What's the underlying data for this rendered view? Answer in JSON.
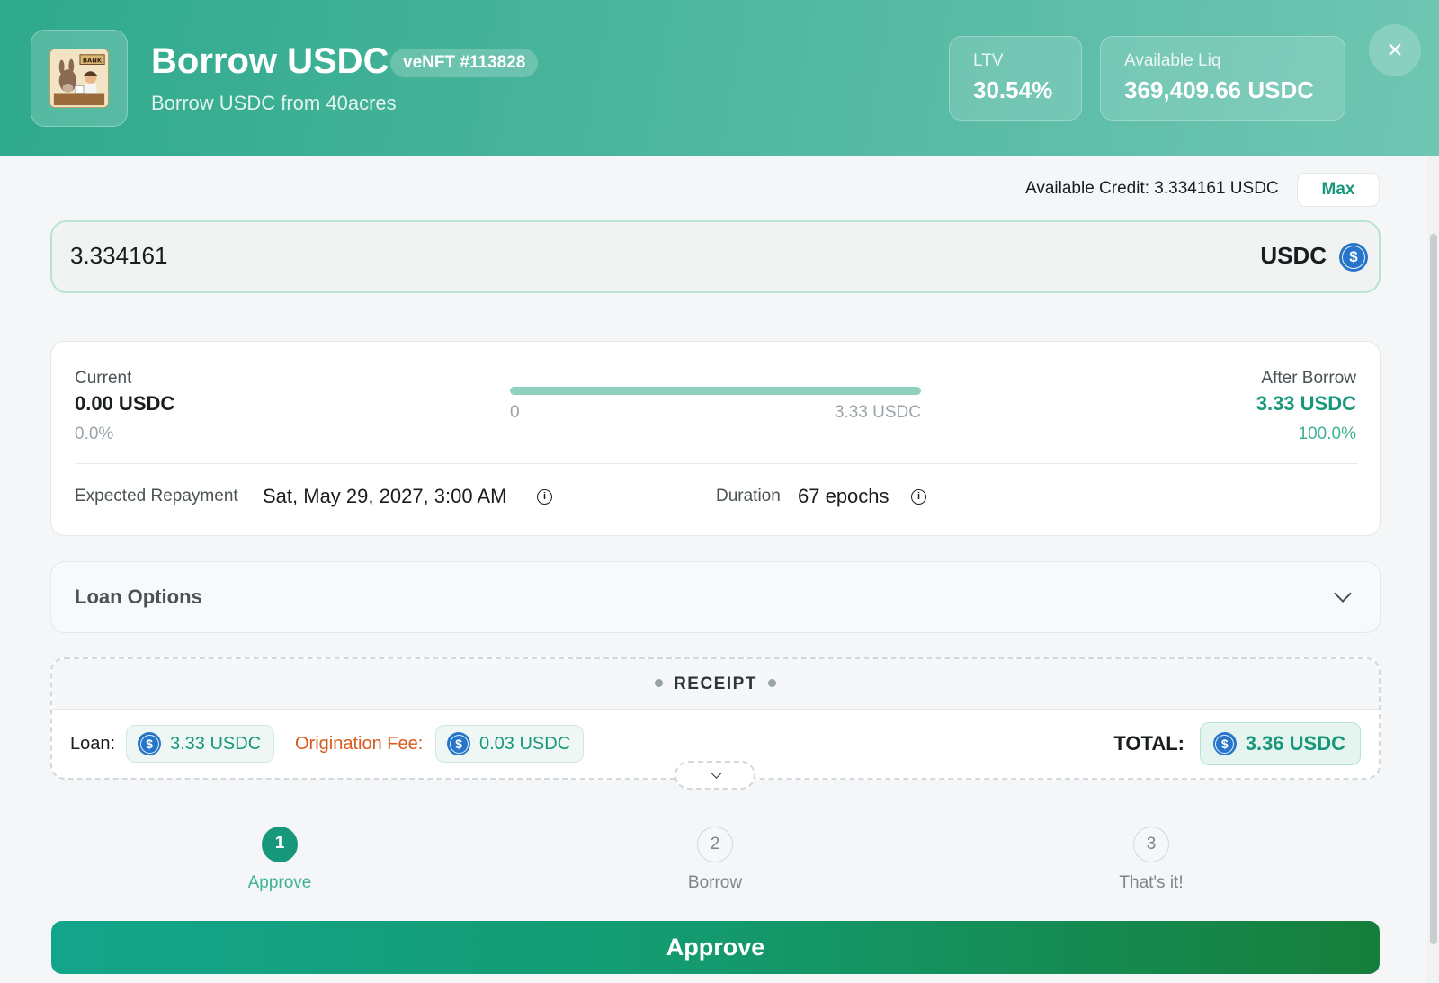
{
  "header": {
    "title": "Borrow USDC",
    "nft_badge": "veNFT #113828",
    "subtitle": "Borrow USDC from 40acres",
    "logo_text": "BANK",
    "stats": {
      "ltv_label": "LTV",
      "ltv_value": "30.54%",
      "liq_label": "Available Liq",
      "liq_value": "369,409.66 USDC"
    },
    "close_icon": "×"
  },
  "credit": {
    "text": "Available Credit: 3.334161 USDC",
    "max_label": "Max"
  },
  "amount": {
    "value": "3.334161",
    "unit": "USDC"
  },
  "summary": {
    "current_label": "Current",
    "current_value": "0.00 USDC",
    "current_pct": "0.0%",
    "bar_min": "0",
    "bar_max": "3.33 USDC",
    "bar_fill_fraction": 1.0,
    "after_label": "After Borrow",
    "after_value": "3.33 USDC",
    "after_pct": "100.0%",
    "repayment_label": "Expected Repayment",
    "repayment_value": "Sat, May 29, 2027, 3:00 AM",
    "duration_label": "Duration",
    "duration_value": "67 epochs"
  },
  "loan_options": {
    "label": "Loan Options"
  },
  "receipt": {
    "title": "RECEIPT",
    "loan_label": "Loan:",
    "loan_value": "3.33 USDC",
    "fee_label": "Origination Fee:",
    "fee_value": "0.03 USDC",
    "total_label": "TOTAL:",
    "total_value": "3.36 USDC"
  },
  "steps": [
    {
      "number": "1",
      "label": "Approve"
    },
    {
      "number": "2",
      "label": "Borrow"
    },
    {
      "number": "3",
      "label": "That's it!"
    }
  ],
  "approve_button": "Approve",
  "colors": {
    "accent": "#18987b",
    "fee_label": "#d95a1e",
    "usdc_blue": "#2775ca"
  },
  "icons": {
    "close": "close-icon",
    "info": "info-icon",
    "chevron": "chevron-down-icon",
    "coin": "usdc-coin-icon"
  }
}
